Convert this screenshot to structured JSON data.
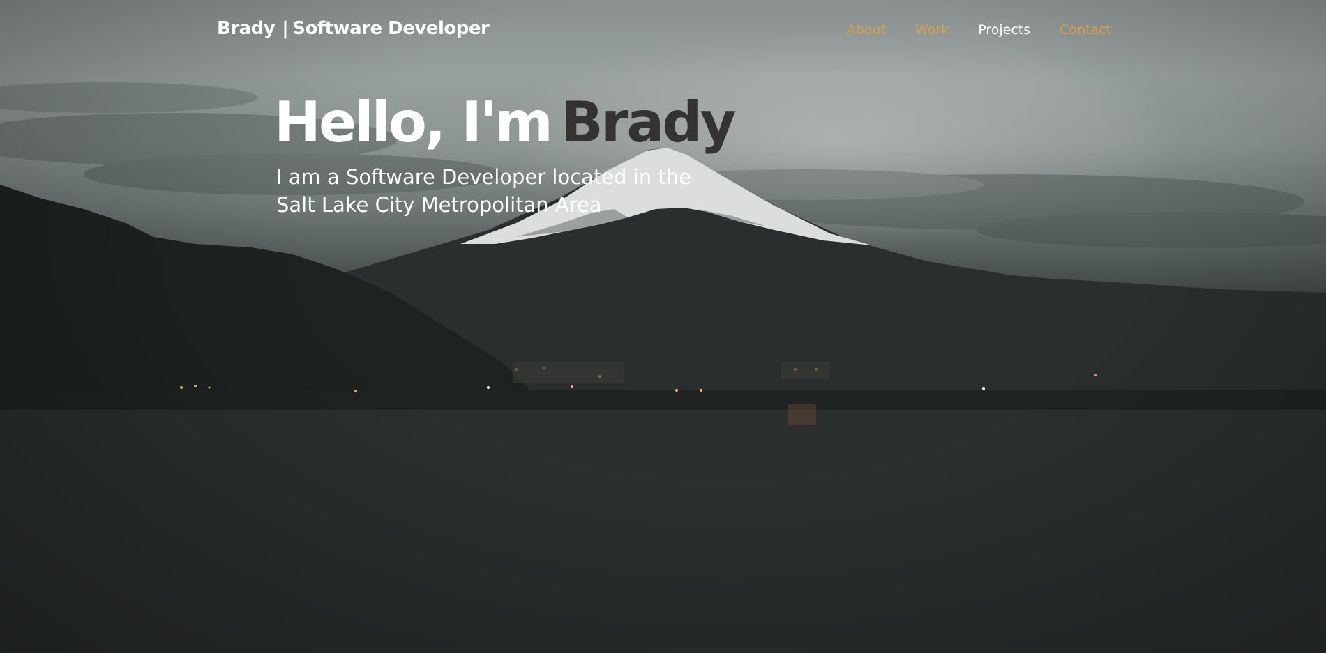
{
  "header": {
    "brand_name": "Brady",
    "brand_separator": "|",
    "brand_role": "Software Developer"
  },
  "nav": {
    "items": [
      {
        "label": "About",
        "active": false
      },
      {
        "label": "Work",
        "active": false
      },
      {
        "label": "Projects",
        "active": true
      },
      {
        "label": "Contact",
        "active": false
      }
    ]
  },
  "hero": {
    "greeting": "Hello, I'm",
    "name": "Brady",
    "subtitle": "I am a Software Developer located in the Salt Lake City Metropolitan Area"
  },
  "colors": {
    "accent": "#d9a04a",
    "active_link": "#ffffff",
    "name_text": "#353232",
    "text": "#ffffff"
  }
}
